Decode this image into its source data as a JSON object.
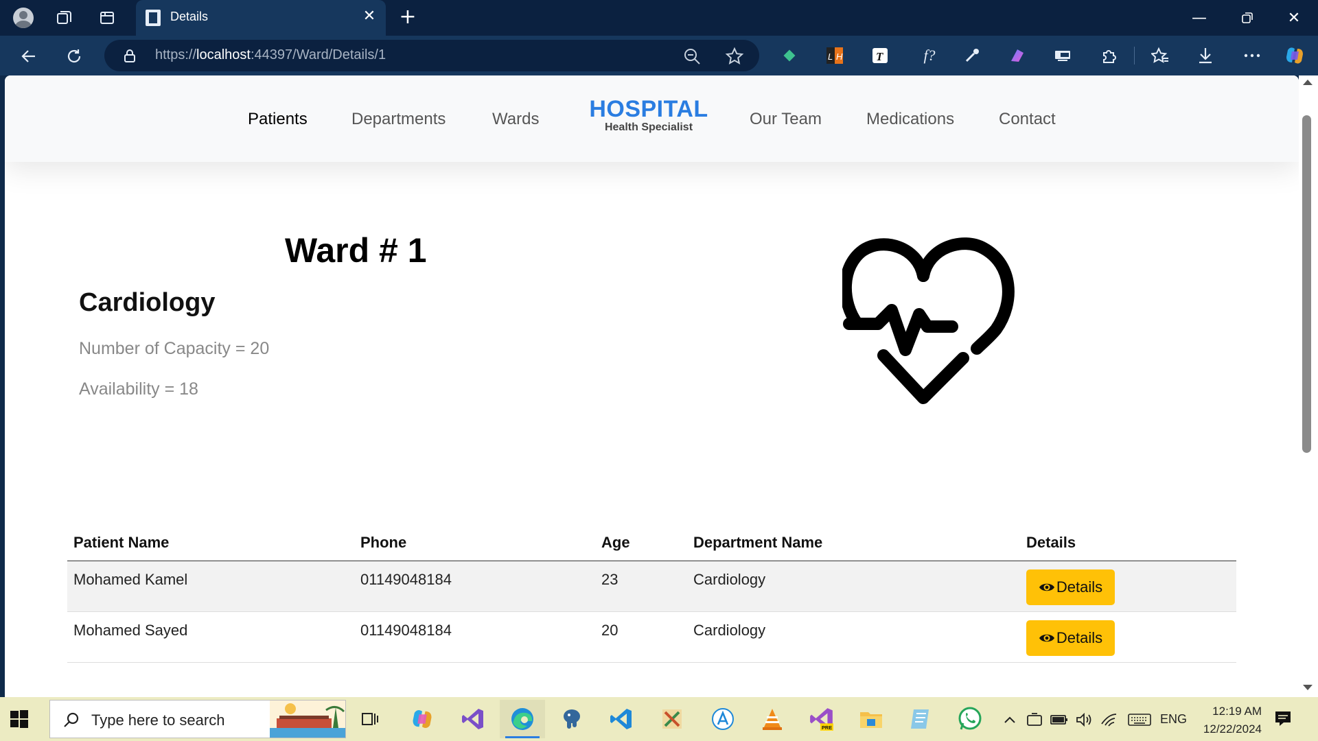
{
  "browser": {
    "tab_title": "Details",
    "url_scheme": "https://",
    "url_host": "localhost",
    "url_path": ":44397/Ward/Details/1"
  },
  "site": {
    "nav": {
      "patients": "Patients",
      "departments": "Departments",
      "wards": "Wards",
      "our_team": "Our Team",
      "medications": "Medications",
      "contact": "Contact"
    },
    "brand": {
      "name": "HOSPITAL",
      "tagline": "Health Specialist"
    },
    "brand_color": "#2a7de1",
    "button_color": "#ffc107"
  },
  "ward": {
    "title": "Ward # 1",
    "department": "Cardiology",
    "capacity_text": "Number of Capacity = 20",
    "availability_text": "Availability = 18",
    "icon": "heartbeat-icon"
  },
  "table": {
    "headers": {
      "patient_name": "Patient Name",
      "phone": "Phone",
      "age": "Age",
      "department_name": "Department Name",
      "details": "Details"
    },
    "rows": [
      {
        "name": "Mohamed Kamel",
        "phone": "01149048184",
        "age": "23",
        "department": "Cardiology",
        "action": "Details"
      },
      {
        "name": "Mohamed Sayed",
        "phone": "01149048184",
        "age": "20",
        "department": "Cardiology",
        "action": "Details"
      }
    ]
  },
  "taskbar": {
    "search_placeholder": "Type here to search",
    "language": "ENG",
    "time": "12:19 AM",
    "date": "12/22/2024"
  }
}
